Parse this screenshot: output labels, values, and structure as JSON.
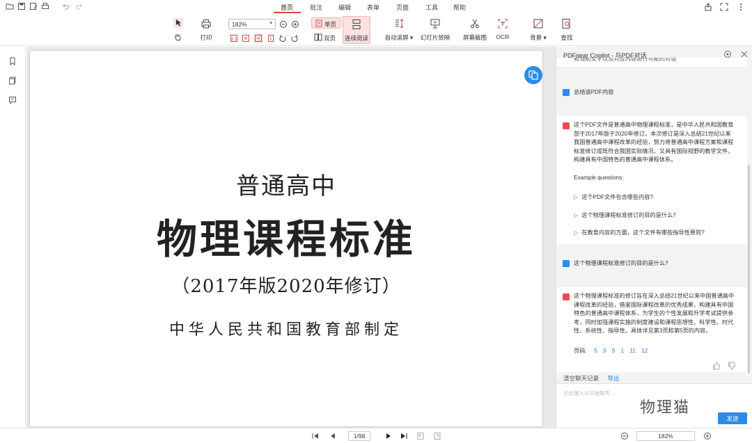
{
  "ribbon_tabs": [
    "首页",
    "批注",
    "编辑",
    "表单",
    "页面",
    "工具",
    "帮助"
  ],
  "active_tab": "首页",
  "toolbar": {
    "print": "打印",
    "zoom": "182%",
    "single_page": "单页",
    "double_page": "双页",
    "continuous": "连续阅读",
    "auto_scroll": "自动滚屏",
    "slideshow": "幻灯片放映",
    "screenshot": "屏幕截图",
    "ocr": "OCR",
    "background": "背景",
    "find": "查找"
  },
  "document": {
    "line1": "普通高中",
    "line2": "物理课程标准",
    "line3": "（2017年版2020年修订）",
    "line4": "中华人民共和国教育部制定"
  },
  "panel": {
    "title": "PDFgear Copilot - 与PDF对话",
    "top_cut_text": "和当前文字以及对应内容进行可能的对话",
    "msg1_user": "总结该PDF内容",
    "msg1_bot_lines": [
      "这个PDF文件是普通高中物理课程标准，是中华人民共和国教育",
      "部于2017年版于2020年修订。本次修订是深入总结21世纪以来",
      "我国普通高中课程改革的经验，努力将普通高中课程方案和课程",
      "标准修订成既符合我国实际情况，又具有国际视野的教学文件，",
      "构建具有中国特色的普通高中课程体系。"
    ],
    "example_heading": "Example questions:",
    "example_questions": [
      "这个PDF文件包含哪些内容?",
      "这个物理课程标准修订的目的是什么?",
      "在教育内容的方面，这个文件有哪些指导性原则?"
    ],
    "msg2_user": "这个物理课程标准修订的目的是什么?",
    "msg2_bot_lines": [
      "这个物理课程标准的修订旨在深入总结21世纪以来中国普通高中",
      "课程改革的经验，借鉴国际课程改革的优秀成果，构建具有中国",
      "特色的普通高中课程体系，为学生的个性发展和升学考试提供参",
      "考，同时加强课程实施的制度建设和课程思想性、科学性、时代",
      "性、系统性、指导性。具体详见第3页和第5页的内容。"
    ],
    "page_ref_label": "页码:",
    "page_refs": [
      "5",
      "3",
      "9",
      "1",
      "11",
      "12"
    ],
    "clear_history": "清空聊天记录",
    "export": "导出",
    "input_placeholder": "在此输入以开始聊天...",
    "send": "发送",
    "watermark": "物理猫"
  },
  "statusbar": {
    "page_indicator": "1/98",
    "zoom": "182%"
  },
  "colors": {
    "accent_blue": "#2c8ae8",
    "active_red": "#d64545",
    "bot_red": "#e84c4c"
  }
}
